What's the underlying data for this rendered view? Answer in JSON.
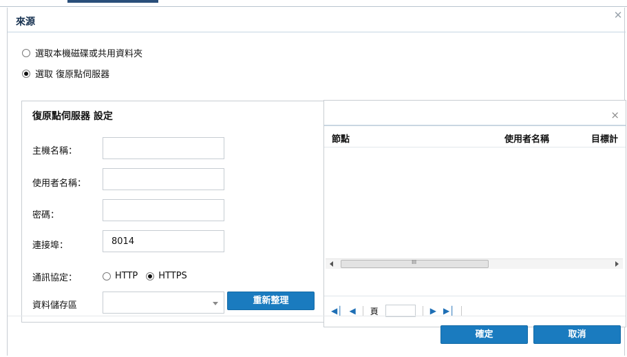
{
  "dialog": {
    "title": "來源"
  },
  "source_options": [
    {
      "label": "選取本機磁碟或共用資料夾",
      "selected": false
    },
    {
      "label": "選取 復原點伺服器",
      "selected": true
    }
  ],
  "settings": {
    "title": "復原點伺服器 設定",
    "host_label": "主機名稱：",
    "host_value": "",
    "user_label": "使用者名稱：",
    "user_value": "",
    "password_label": "密碼：",
    "password_value": "",
    "port_label": "連接埠：",
    "port_value": "8014",
    "protocol_label": "通訊協定：",
    "protocol_http": "HTTP",
    "protocol_https": "HTTPS",
    "protocol_selected": "HTTPS",
    "datastore_label": "資料儲存區",
    "datastore_value": "",
    "refresh_label": "重新整理"
  },
  "grid": {
    "close_glyph": "×",
    "columns": [
      "節點",
      "使用者名稱",
      "目標計"
    ],
    "scroll_grip": "III",
    "page_label": "頁",
    "page_value": ""
  },
  "footer": {
    "ok_label": "確定",
    "cancel_label": "取消"
  },
  "colors": {
    "button_blue": "#1a7bbf",
    "title_text": "#15304f",
    "pager_icon": "#1e6fb5"
  }
}
